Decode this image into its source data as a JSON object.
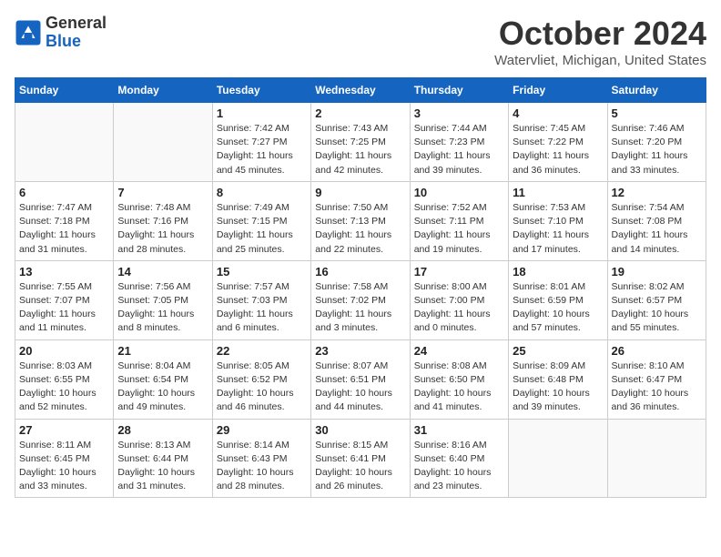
{
  "header": {
    "logo_line1": "General",
    "logo_line2": "Blue",
    "month": "October 2024",
    "location": "Watervliet, Michigan, United States"
  },
  "weekdays": [
    "Sunday",
    "Monday",
    "Tuesday",
    "Wednesday",
    "Thursday",
    "Friday",
    "Saturday"
  ],
  "weeks": [
    [
      {
        "day": "",
        "sunrise": "",
        "sunset": "",
        "daylight": ""
      },
      {
        "day": "",
        "sunrise": "",
        "sunset": "",
        "daylight": ""
      },
      {
        "day": "1",
        "sunrise": "Sunrise: 7:42 AM",
        "sunset": "Sunset: 7:27 PM",
        "daylight": "Daylight: 11 hours and 45 minutes."
      },
      {
        "day": "2",
        "sunrise": "Sunrise: 7:43 AM",
        "sunset": "Sunset: 7:25 PM",
        "daylight": "Daylight: 11 hours and 42 minutes."
      },
      {
        "day": "3",
        "sunrise": "Sunrise: 7:44 AM",
        "sunset": "Sunset: 7:23 PM",
        "daylight": "Daylight: 11 hours and 39 minutes."
      },
      {
        "day": "4",
        "sunrise": "Sunrise: 7:45 AM",
        "sunset": "Sunset: 7:22 PM",
        "daylight": "Daylight: 11 hours and 36 minutes."
      },
      {
        "day": "5",
        "sunrise": "Sunrise: 7:46 AM",
        "sunset": "Sunset: 7:20 PM",
        "daylight": "Daylight: 11 hours and 33 minutes."
      }
    ],
    [
      {
        "day": "6",
        "sunrise": "Sunrise: 7:47 AM",
        "sunset": "Sunset: 7:18 PM",
        "daylight": "Daylight: 11 hours and 31 minutes."
      },
      {
        "day": "7",
        "sunrise": "Sunrise: 7:48 AM",
        "sunset": "Sunset: 7:16 PM",
        "daylight": "Daylight: 11 hours and 28 minutes."
      },
      {
        "day": "8",
        "sunrise": "Sunrise: 7:49 AM",
        "sunset": "Sunset: 7:15 PM",
        "daylight": "Daylight: 11 hours and 25 minutes."
      },
      {
        "day": "9",
        "sunrise": "Sunrise: 7:50 AM",
        "sunset": "Sunset: 7:13 PM",
        "daylight": "Daylight: 11 hours and 22 minutes."
      },
      {
        "day": "10",
        "sunrise": "Sunrise: 7:52 AM",
        "sunset": "Sunset: 7:11 PM",
        "daylight": "Daylight: 11 hours and 19 minutes."
      },
      {
        "day": "11",
        "sunrise": "Sunrise: 7:53 AM",
        "sunset": "Sunset: 7:10 PM",
        "daylight": "Daylight: 11 hours and 17 minutes."
      },
      {
        "day": "12",
        "sunrise": "Sunrise: 7:54 AM",
        "sunset": "Sunset: 7:08 PM",
        "daylight": "Daylight: 11 hours and 14 minutes."
      }
    ],
    [
      {
        "day": "13",
        "sunrise": "Sunrise: 7:55 AM",
        "sunset": "Sunset: 7:07 PM",
        "daylight": "Daylight: 11 hours and 11 minutes."
      },
      {
        "day": "14",
        "sunrise": "Sunrise: 7:56 AM",
        "sunset": "Sunset: 7:05 PM",
        "daylight": "Daylight: 11 hours and 8 minutes."
      },
      {
        "day": "15",
        "sunrise": "Sunrise: 7:57 AM",
        "sunset": "Sunset: 7:03 PM",
        "daylight": "Daylight: 11 hours and 6 minutes."
      },
      {
        "day": "16",
        "sunrise": "Sunrise: 7:58 AM",
        "sunset": "Sunset: 7:02 PM",
        "daylight": "Daylight: 11 hours and 3 minutes."
      },
      {
        "day": "17",
        "sunrise": "Sunrise: 8:00 AM",
        "sunset": "Sunset: 7:00 PM",
        "daylight": "Daylight: 11 hours and 0 minutes."
      },
      {
        "day": "18",
        "sunrise": "Sunrise: 8:01 AM",
        "sunset": "Sunset: 6:59 PM",
        "daylight": "Daylight: 10 hours and 57 minutes."
      },
      {
        "day": "19",
        "sunrise": "Sunrise: 8:02 AM",
        "sunset": "Sunset: 6:57 PM",
        "daylight": "Daylight: 10 hours and 55 minutes."
      }
    ],
    [
      {
        "day": "20",
        "sunrise": "Sunrise: 8:03 AM",
        "sunset": "Sunset: 6:55 PM",
        "daylight": "Daylight: 10 hours and 52 minutes."
      },
      {
        "day": "21",
        "sunrise": "Sunrise: 8:04 AM",
        "sunset": "Sunset: 6:54 PM",
        "daylight": "Daylight: 10 hours and 49 minutes."
      },
      {
        "day": "22",
        "sunrise": "Sunrise: 8:05 AM",
        "sunset": "Sunset: 6:52 PM",
        "daylight": "Daylight: 10 hours and 46 minutes."
      },
      {
        "day": "23",
        "sunrise": "Sunrise: 8:07 AM",
        "sunset": "Sunset: 6:51 PM",
        "daylight": "Daylight: 10 hours and 44 minutes."
      },
      {
        "day": "24",
        "sunrise": "Sunrise: 8:08 AM",
        "sunset": "Sunset: 6:50 PM",
        "daylight": "Daylight: 10 hours and 41 minutes."
      },
      {
        "day": "25",
        "sunrise": "Sunrise: 8:09 AM",
        "sunset": "Sunset: 6:48 PM",
        "daylight": "Daylight: 10 hours and 39 minutes."
      },
      {
        "day": "26",
        "sunrise": "Sunrise: 8:10 AM",
        "sunset": "Sunset: 6:47 PM",
        "daylight": "Daylight: 10 hours and 36 minutes."
      }
    ],
    [
      {
        "day": "27",
        "sunrise": "Sunrise: 8:11 AM",
        "sunset": "Sunset: 6:45 PM",
        "daylight": "Daylight: 10 hours and 33 minutes."
      },
      {
        "day": "28",
        "sunrise": "Sunrise: 8:13 AM",
        "sunset": "Sunset: 6:44 PM",
        "daylight": "Daylight: 10 hours and 31 minutes."
      },
      {
        "day": "29",
        "sunrise": "Sunrise: 8:14 AM",
        "sunset": "Sunset: 6:43 PM",
        "daylight": "Daylight: 10 hours and 28 minutes."
      },
      {
        "day": "30",
        "sunrise": "Sunrise: 8:15 AM",
        "sunset": "Sunset: 6:41 PM",
        "daylight": "Daylight: 10 hours and 26 minutes."
      },
      {
        "day": "31",
        "sunrise": "Sunrise: 8:16 AM",
        "sunset": "Sunset: 6:40 PM",
        "daylight": "Daylight: 10 hours and 23 minutes."
      },
      {
        "day": "",
        "sunrise": "",
        "sunset": "",
        "daylight": ""
      },
      {
        "day": "",
        "sunrise": "",
        "sunset": "",
        "daylight": ""
      }
    ]
  ]
}
